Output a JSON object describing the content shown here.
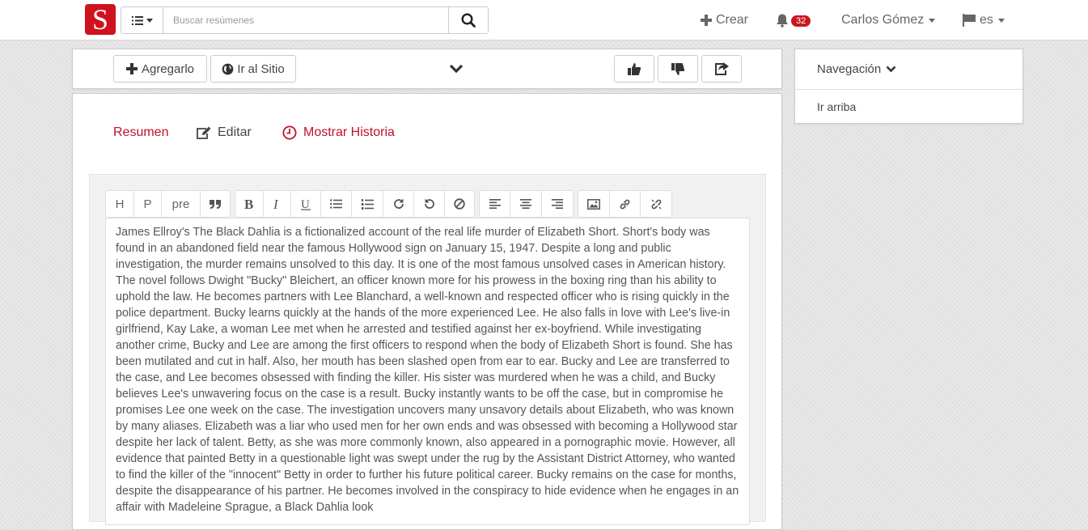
{
  "header": {
    "logo_letter": "S",
    "search_placeholder": "Buscar resúmenes",
    "create_label": "Crear",
    "notification_count": "32",
    "user_name": "Carlos Gómez",
    "language": "es"
  },
  "actionbar": {
    "add_label": "Agregarlo",
    "site_label": "Ir al Sitio"
  },
  "sidebar": {
    "nav_title": "Navegación",
    "top_link": "Ir arriba"
  },
  "tabs": {
    "summary": "Resumen",
    "edit": "Editar",
    "history": "Mostrar Historia"
  },
  "toolbar": {
    "h": "H",
    "p": "P",
    "pre": "pre"
  },
  "colors": {
    "brand": "#d0121e",
    "accent_text": "#c0102a"
  },
  "icons": [
    "list-icon",
    "search-icon",
    "plus-icon",
    "bell-icon",
    "flag-icon",
    "globe-icon",
    "chevron-down-icon",
    "thumbs-up-icon",
    "thumbs-down-icon",
    "share-icon",
    "pencil-icon",
    "clock-icon",
    "quote-icon",
    "bold-icon",
    "italic-icon",
    "underline-icon",
    "bullet-list-icon",
    "numbered-list-icon",
    "redo-icon",
    "undo-icon",
    "clear-icon",
    "align-left-icon",
    "align-center-icon",
    "align-right-icon",
    "image-icon",
    "link-icon",
    "unlink-icon"
  ],
  "editor": {
    "content": "James Ellroy's The Black Dahlia is a fictionalized account of the real life murder of Elizabeth Short. Short's body was found in an abandoned field near the famous Hollywood sign on January 15, 1947. Despite a long and public investigation, the murder remains unsolved to this day. It is one of the most famous unsolved cases in American history. The novel follows Dwight \"Bucky\" Bleichert, an officer known more for his prowess in the boxing ring than his ability to uphold the law. He becomes partners with Lee Blanchard, a well-known and respected officer who is rising quickly in the police department. Bucky learns quickly at the hands of the more experienced Lee. He also falls in love with Lee's live-in girlfriend, Kay Lake, a woman Lee met when he arrested and testified against her ex-boyfriend. While investigating another crime, Bucky and Lee are among the first officers to respond when the body of Elizabeth Short is found. She has been mutilated and cut in half. Also, her mouth has been slashed open from ear to ear. Bucky and Lee are transferred to the case, and Lee becomes obsessed with finding the killer. His sister was murdered when he was a child, and Bucky believes Lee's unwavering focus on the case is a result. Bucky instantly wants to be off the case, but in compromise he promises Lee one week on the case. The investigation uncovers many unsavory details about Elizabeth, who was known by many aliases. Elizabeth was a liar who used men for her own ends and was obsessed with becoming a Hollywood star despite her lack of talent. Betty, as she was more commonly known, also appeared in a pornographic movie. However, all evidence that painted Betty in a questionable light was swept under the rug by the Assistant District Attorney, who wanted to find the killer of the \"innocent\" Betty in order to further his future political career. Bucky remains on the case for months, despite the disappearance of his partner. He becomes involved in the conspiracy to hide evidence when he engages in an affair with Madeleine Sprague, a Black Dahlia look"
  }
}
